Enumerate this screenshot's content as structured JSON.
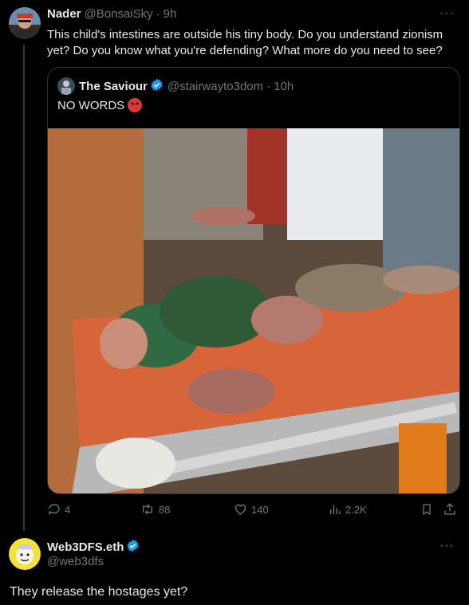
{
  "tweet": {
    "author_name": "Nader",
    "handle": "@BonsaiSky",
    "separator": "·",
    "time": "9h",
    "more": "···",
    "text": "This child's intestines are outside his tiny body. Do you understand zionism yet? Do you know what you're defending? What more do you need to see?"
  },
  "quote": {
    "author_name": "The Saviour",
    "handle": "@stairwayto3dom",
    "separator": "·",
    "time": "10h",
    "text": "NO WORDS",
    "emoji": "angry-face-emoji",
    "media": "photo of injured child on stretcher"
  },
  "actions": {
    "replies": "4",
    "reposts": "88",
    "likes": "140",
    "views": "2.2K"
  },
  "reply": {
    "author_name": "Web3DFS.eth",
    "handle": "@web3dfs",
    "more": "···",
    "text": "They release the hostages yet?"
  },
  "colors": {
    "background": "#000000",
    "text": "#e7e9ea",
    "muted": "#71767b",
    "border": "#2f3336",
    "verified": "#1d9bf0"
  }
}
